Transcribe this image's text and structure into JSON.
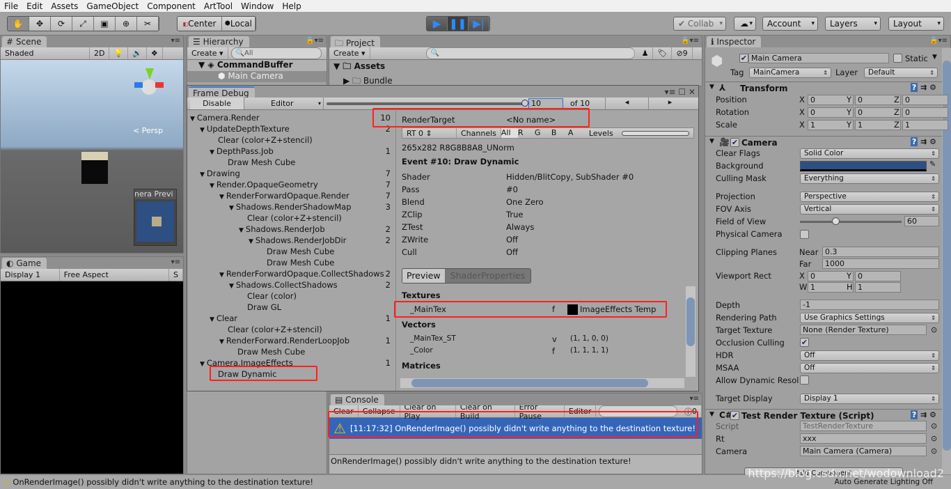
{
  "menu": [
    "File",
    "Edit",
    "Assets",
    "GameObject",
    "Component",
    "ArtTool",
    "Window",
    "Help"
  ],
  "toolbar": {
    "tools": [
      "hand-icon",
      "move-icon",
      "rotate-icon",
      "scale-icon",
      "rect-icon",
      "transform-icon",
      "custom-tool-icon"
    ],
    "tool_glyphs": [
      "✋",
      "✥",
      "⟳",
      "⤢",
      "▣",
      "⊕",
      "✂"
    ],
    "pivot": "Center",
    "space": "Local",
    "collab": "Collab",
    "account": "Account",
    "layers": "Layers",
    "layout": "Layout",
    "play_color": "#2a8bff"
  },
  "scene": {
    "tab": "Scene",
    "shading": "Shaded",
    "mode2d": "2D",
    "persp": "< Persp",
    "preview_label": "nera Previ"
  },
  "game": {
    "tab": "Game",
    "display": "Display 1",
    "aspect": "Free Aspect",
    "scale": "S"
  },
  "hierarchy": {
    "tab": "Hierarchy",
    "create": "Create",
    "search": "All",
    "scene": "CommandBuffer",
    "items": [
      "Main Camera"
    ]
  },
  "project": {
    "tab": "Project",
    "create": "Create",
    "hidden_count": "9",
    "folders": [
      "Assets",
      "Bundle"
    ]
  },
  "frame_debug": {
    "title": "Frame Debug",
    "disable": "Disable",
    "target": "Editor",
    "event": "10",
    "of": "of 10",
    "slider_fraction": 1.0,
    "tree": [
      {
        "label": "Camera.Render",
        "level": 0,
        "count": "10",
        "group": true
      },
      {
        "label": "UpdateDepthTexture",
        "level": 1,
        "count": "2",
        "group": true
      },
      {
        "label": "Clear (color+Z+stencil)",
        "level": 2,
        "count": "",
        "group": false
      },
      {
        "label": "DepthPass.Job",
        "level": 2,
        "count": "1",
        "group": true
      },
      {
        "label": "Draw Mesh Cube",
        "level": 3,
        "count": "",
        "group": false
      },
      {
        "label": "Drawing",
        "level": 1,
        "count": "7",
        "group": true
      },
      {
        "label": "Render.OpaqueGeometry",
        "level": 2,
        "count": "7",
        "group": true
      },
      {
        "label": "RenderForwardOpaque.Render",
        "level": 3,
        "count": "7",
        "group": true
      },
      {
        "label": "Shadows.RenderShadowMap",
        "level": 4,
        "count": "3",
        "group": true
      },
      {
        "label": "Clear (color+Z+stencil)",
        "level": 5,
        "count": "",
        "group": false
      },
      {
        "label": "Shadows.RenderJob",
        "level": 5,
        "count": "2",
        "group": true
      },
      {
        "label": "Shadows.RenderJobDir",
        "level": 6,
        "count": "2",
        "group": true
      },
      {
        "label": "Draw Mesh Cube",
        "level": 7,
        "count": "",
        "group": false
      },
      {
        "label": "Draw Mesh Cube",
        "level": 7,
        "count": "",
        "group": false
      },
      {
        "label": "RenderForwardOpaque.CollectShadows",
        "level": 3,
        "count": "2",
        "group": true
      },
      {
        "label": "Shadows.CollectShadows",
        "level": 4,
        "count": "2",
        "group": true
      },
      {
        "label": "Clear (color)",
        "level": 5,
        "count": "",
        "group": false
      },
      {
        "label": "Draw GL",
        "level": 5,
        "count": "",
        "group": false
      },
      {
        "label": "Clear",
        "level": 2,
        "count": "1",
        "group": true
      },
      {
        "label": "Clear (color+Z+stencil)",
        "level": 3,
        "count": "",
        "group": false
      },
      {
        "label": "RenderForward.RenderLoopJob",
        "level": 3,
        "count": "1",
        "group": true
      },
      {
        "label": "Draw Mesh Cube",
        "level": 4,
        "count": "",
        "group": false
      },
      {
        "label": "Camera.ImageEffects",
        "level": 1,
        "count": "1",
        "group": true
      },
      {
        "label": "Draw Dynamic",
        "level": 2,
        "count": "",
        "group": false
      }
    ],
    "render_target_label": "RenderTarget",
    "render_target_value": "<No name>",
    "rt": "RT 0",
    "channels": "Channels",
    "channel_buttons": [
      "All",
      "R",
      "G",
      "B",
      "A"
    ],
    "levels": "Levels",
    "format": "265x282 R8G8B8A8_UNorm",
    "event_title": "Event #10: Draw Dynamic",
    "props": [
      [
        "Shader",
        "Hidden/BlitCopy, SubShader #0"
      ],
      [
        "Pass",
        "#0"
      ],
      [
        "Blend",
        "One Zero"
      ],
      [
        "ZClip",
        "True"
      ],
      [
        "ZTest",
        "Always"
      ],
      [
        "ZWrite",
        "Off"
      ],
      [
        "Cull",
        "Off"
      ]
    ],
    "tabs": [
      "Preview",
      "ShaderProperties"
    ],
    "textures_header": "Textures",
    "textures": [
      {
        "name": "_MainTex",
        "stage": "f",
        "value": "ImageEffects Temp"
      }
    ],
    "vectors_header": "Vectors",
    "vectors": [
      {
        "name": "_MainTex_ST",
        "stage": "v",
        "value": "(1, 1, 0, 0)"
      },
      {
        "name": "_Color",
        "stage": "f",
        "value": "(1, 1, 1, 1)"
      }
    ],
    "matrices_header": "Matrices"
  },
  "console": {
    "tab": "Console",
    "buttons": [
      "Clear",
      "Collapse",
      "Clear on Play",
      "Clear on Build",
      "Error Pause",
      "Editor"
    ],
    "count": "0",
    "entry": "[11:17:32] OnRenderImage() possibly didn't write anything to the destination texture!",
    "detail": "OnRenderImage() possibly didn't write anything to the destination texture!",
    "selected_color": "#3465b9"
  },
  "inspector": {
    "tab": "Inspector",
    "name": "Main Camera",
    "static": "Static",
    "tag_label": "Tag",
    "tag": "MainCamera",
    "layer_label": "Layer",
    "layer": "Default",
    "transform": {
      "title": "Transform",
      "rows": [
        {
          "label": "Position",
          "x": "0",
          "y": "0",
          "z": "0"
        },
        {
          "label": "Rotation",
          "x": "0",
          "y": "0",
          "z": "0"
        },
        {
          "label": "Scale",
          "x": "1",
          "y": "1",
          "z": "1"
        }
      ]
    },
    "camera": {
      "title": "Camera",
      "clear_flags": [
        "Clear Flags",
        "Solid Color"
      ],
      "background": [
        "Background",
        "#2e4f82"
      ],
      "culling_mask": [
        "Culling Mask",
        "Everything"
      ],
      "projection": [
        "Projection",
        "Perspective"
      ],
      "fov_axis": [
        "FOV Axis",
        "Vertical"
      ],
      "fov": [
        "Field of View",
        "60"
      ],
      "fov_fraction": 0.33,
      "physical": "Physical Camera",
      "clipping": "Clipping Planes",
      "near_label": "Near",
      "near": "0.3",
      "far_label": "Far",
      "far": "1000",
      "viewport": "Viewport Rect",
      "vx": "0",
      "vy": "0",
      "vw": "1",
      "vh": "1",
      "depth": [
        "Depth",
        "-1"
      ],
      "rendering_path": [
        "Rendering Path",
        "Use Graphics Settings"
      ],
      "target_texture": [
        "Target Texture",
        "None (Render Texture)"
      ],
      "occlusion": "Occlusion Culling",
      "hdr": [
        "HDR",
        "Off"
      ],
      "msaa": [
        "MSAA",
        "Off"
      ],
      "dynamic_res": "Allow Dynamic Resol",
      "target_display": [
        "Target Display",
        "Display 1"
      ]
    },
    "script": {
      "title": "Test Render Texture (Script)",
      "script": [
        "Script",
        "TestRenderTexture"
      ],
      "rt": [
        "Rt",
        "xxx"
      ],
      "camera": [
        "Camera",
        "Main Camera (Camera)"
      ]
    },
    "add_component": "Add Component"
  },
  "status": {
    "message": "OnRenderImage() possibly didn't write anything to the destination texture!",
    "lighting": "Auto Generate Lighting Off",
    "watermark": "https://blog.csdn.net/wodownload2"
  }
}
